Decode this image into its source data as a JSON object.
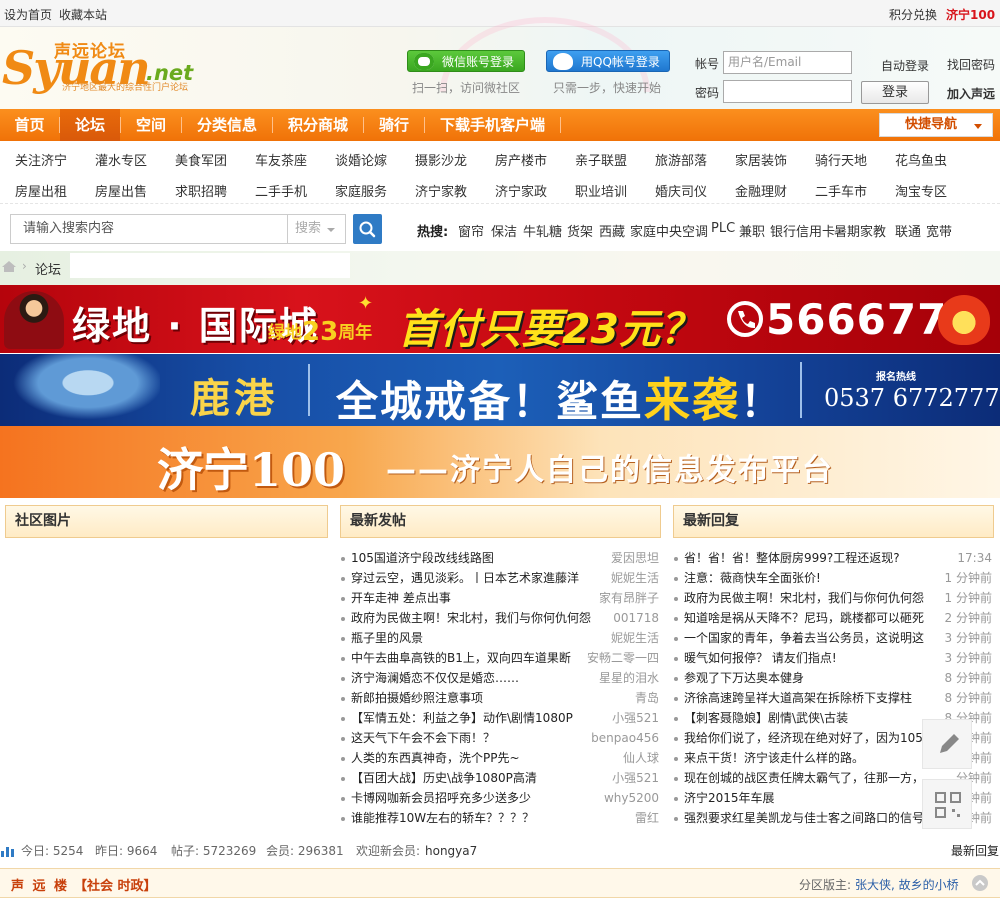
{
  "topbar": {
    "set_home": "设为首页",
    "bookmark": "收藏本站",
    "points": "积分兑换",
    "brand": "济宁100"
  },
  "header": {
    "logo": {
      "main": "Syuan",
      "net": ".net",
      "cn": "声远论坛",
      "slogan": "济宁地区最大的综合性门户论坛"
    },
    "wechat_login": "微信账号登录",
    "wechat_hint": "扫一扫，访问微社区",
    "qq_login": "用QQ帐号登录",
    "qq_hint": "只需一步，快速开始",
    "account_label": "帐号",
    "account_placeholder": "用户名/Email",
    "password_label": "密码",
    "auto_login": "自动登录",
    "forgot": "找回密码",
    "login_button": "登录",
    "join": "加入声远"
  },
  "nav": {
    "items": [
      "首页",
      "论坛",
      "空间",
      "分类信息",
      "积分商城",
      "骑行",
      "下载手机客户端"
    ],
    "quick_nav": "快捷导航"
  },
  "subnav": {
    "row1": [
      "关注济宁",
      "灌水专区",
      "美食军团",
      "车友茶座",
      "谈婚论嫁",
      "摄影沙龙",
      "房产楼市",
      "亲子联盟",
      "旅游部落",
      "家居装饰",
      "骑行天地",
      "花鸟鱼虫"
    ],
    "row2": [
      "房屋出租",
      "房屋出售",
      "求职招聘",
      "二手手机",
      "家庭服务",
      "济宁家教",
      "济宁家政",
      "职业培训",
      "婚庆司仪",
      "金融理财",
      "二手车市",
      "淘宝专区"
    ]
  },
  "search": {
    "placeholder": "请输入搜索内容",
    "select": "搜索",
    "hot_label": "热搜:",
    "hot": [
      "窗帘",
      "保洁",
      "牛轧糖",
      "货架",
      "西藏",
      "家庭中央空调",
      "PLC",
      "兼职",
      "银行信用卡",
      "暑期家教",
      "联通",
      "宽带"
    ]
  },
  "breadcrumb": {
    "forum": "论坛"
  },
  "banners": {
    "b1": {
      "name": "绿地 · 国际城",
      "anniv": "绿地",
      "anniv_num": "23",
      "anniv_suffix": "周年",
      "offer": "首付只要23元？",
      "phone": "5666777"
    },
    "b2": {
      "name": "鹿港",
      "slogan1": "全城戒备！鲨鱼",
      "slogan2": "来袭",
      "slogan3": "！",
      "hotline_label": "报名热线",
      "hotline": "0537 6772777"
    },
    "b3": {
      "name": "济宁100",
      "slogan": "——济宁人自己的信息发布平台"
    }
  },
  "panels": {
    "photos": {
      "title": "社区图片"
    },
    "new_posts": {
      "title": "最新发帖",
      "rows": [
        {
          "t": "105国道济宁段改线线路图",
          "a": "爱因思坦"
        },
        {
          "t": "穿过云空，遇见淡彩。丨日本艺术家進藤洋",
          "a": "妮妮生活"
        },
        {
          "t": "开车走神 差点出事",
          "a": "家有昂胖子"
        },
        {
          "t": "政府为民做主啊！宋北村，我们与你何仇何怨",
          "a": "001718"
        },
        {
          "t": "瓶子里的风景",
          "a": "妮妮生活"
        },
        {
          "t": "中午去曲阜高铁的B1上，双向四车道果断",
          "a": "安畅二零一四"
        },
        {
          "t": "济宁海澜婚恋不仅仅是婚恋……",
          "a": "星星的泪水"
        },
        {
          "t": "新郎拍摄婚纱照注意事项",
          "a": "青岛"
        },
        {
          "t": "【军情五处：利益之争】动作\\剧情1080P",
          "a": "小强521"
        },
        {
          "t": "这天气下午会不会下雨！？",
          "a": "benpao456"
        },
        {
          "t": "人类的东西真神奇，洗个PP先~",
          "a": "仙人球"
        },
        {
          "t": "【百团大战】历史\\战争1080P高清",
          "a": "小强521"
        },
        {
          "t": "卡博网咖新会员招呼充多少送多少",
          "a": "why5200"
        },
        {
          "t": "谁能推荐10W左右的轿车？？？？",
          "a": "雷红"
        }
      ]
    },
    "replies": {
      "title": "最新回复",
      "rows": [
        {
          "t": "省！省！省！整体厨房999?工程还返现?",
          "a": "17:34"
        },
        {
          "t": "注意：薇商快车全面张价!",
          "a": "1 分钟前"
        },
        {
          "t": "政府为民做主啊！宋北村，我们与你何仇何怨",
          "a": "1 分钟前"
        },
        {
          "t": "知道啥是祸从天降不？尼玛，跳楼都可以砸死",
          "a": "2 分钟前"
        },
        {
          "t": "一个国家的青年，争着去当公务员，这说明这",
          "a": "3 分钟前"
        },
        {
          "t": "暖气如何报停？ 请友们指点!",
          "a": "3 分钟前"
        },
        {
          "t": "参观了下万达奥本健身",
          "a": "8 分钟前"
        },
        {
          "t": "济徐高速跨呈祥大道高架在拆除桥下支撑柱",
          "a": "8 分钟前"
        },
        {
          "t": "【刺客聂隐娘】剧情\\武侠\\古装",
          "a": "8 分钟前"
        },
        {
          "t": "我给你们说了，经济现在绝对好了，因为105",
          "a": "分钟前"
        },
        {
          "t": "来点干货！济宁该走什么样的路。",
          "a": "分钟前"
        },
        {
          "t": "现在创城的战区责任牌太霸气了，往那一方，",
          "a": "分钟前"
        },
        {
          "t": "济宁2015年车展",
          "a": "分钟前"
        },
        {
          "t": "强烈要求红星美凯龙与佳士客之间路口的信号",
          "a": "分钟前"
        }
      ]
    }
  },
  "stats": {
    "today": "今日: 5254",
    "yesterday": "昨日: 9664",
    "posts": "帖子: 5723269",
    "members": "会员: 296381",
    "welcome_label": "欢迎新会员:",
    "welcome_user": "hongya7",
    "latest_reply": "最新回复"
  },
  "section": {
    "name": "声 远 楼",
    "category": "【社会 时政】",
    "moderator_label": "分区版主:",
    "moderators": "张大侠, 故乡的小桥"
  }
}
